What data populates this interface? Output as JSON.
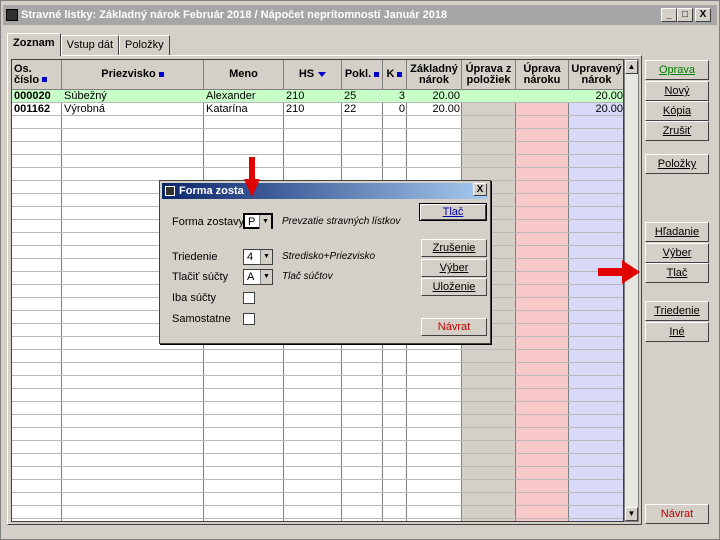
{
  "window": {
    "title": "Stravné lístky:  Základný nárok Február 2018  /  Nápočet neprítomností Január 2018",
    "minimize": "_",
    "maximize": "□",
    "close": "X"
  },
  "tabs": [
    {
      "label": "Zoznam",
      "active": true
    },
    {
      "label": "Vstup dát",
      "active": false
    },
    {
      "label": "Položky",
      "active": false
    }
  ],
  "table": {
    "columns": [
      {
        "label1": "Os.",
        "label2": "číslo",
        "sort": "marker"
      },
      {
        "label1": "Priezvisko",
        "label2": "",
        "sort": "marker"
      },
      {
        "label1": "Meno",
        "label2": "",
        "sort": "none"
      },
      {
        "label1": "HS",
        "label2": "",
        "sort": "desc"
      },
      {
        "label1": "Pokl.",
        "label2": "",
        "sort": "marker"
      },
      {
        "label1": "K",
        "label2": "",
        "sort": "marker"
      },
      {
        "label1": "Základný",
        "label2": "nárok",
        "sort": "none"
      },
      {
        "label1": "Úprava z",
        "label2": "položiek",
        "sort": "none"
      },
      {
        "label1": "Úprava",
        "label2": "nároku",
        "sort": "none"
      },
      {
        "label1": "Upravený",
        "label2": "nárok",
        "sort": "none"
      }
    ],
    "rows": [
      {
        "os": "000020",
        "priezvisko": "Súbežný",
        "meno": "Alexander",
        "hs": "210",
        "pokl": "25",
        "k": "3",
        "zakladny": "20.00",
        "uprava_pol": "",
        "uprava_nar": "",
        "upraveny": "20.00",
        "selected": true
      },
      {
        "os": "001162",
        "priezvisko": "Výrobná",
        "meno": "Katarína",
        "hs": "210",
        "pokl": "22",
        "k": "0",
        "zakladny": "20.00",
        "uprava_pol": "",
        "uprava_nar": "",
        "upraveny": "20.00",
        "selected": false
      }
    ],
    "column_colors": {
      "uprava_pol": "#d4d0c8",
      "uprava_nar": "#f8c8c8",
      "upraveny": "#d8d8f8",
      "selected_row": "#c8ffc8"
    }
  },
  "scrollbar": {
    "up": "▲",
    "down": "▼"
  },
  "side_buttons": {
    "oprava": "Oprava",
    "novy": "Nový",
    "kopia": "Kópia",
    "zrusit": "Zrušiť",
    "polozky": "Položky",
    "hladanie": "Hľadanie",
    "vyber": "Výber",
    "tlac": "Tlač",
    "triedenie": "Triedenie",
    "ine": "Iné",
    "navrat": "Návrat"
  },
  "dialog": {
    "title": "Forma zosta",
    "close": "X",
    "forma_label": "Forma zostavy",
    "forma_value": "P",
    "forma_hint": "Prevzatie stravných lístkov",
    "triedenie_label": "Triedenie",
    "triedenie_value": "4",
    "triedenie_hint": "Stredisko+Priezvisko",
    "tlac_suctov_label": "Tlačiť súčty",
    "tlac_suctov_value": "A",
    "tlac_suctov_hint": "Tlač súčtov",
    "iba_sucty_label": "Iba súčty",
    "samostatne_label": "Samostatne",
    "btn_tlac": "Tlač",
    "btn_zrusenie": "Zrušenie",
    "btn_vyber": "Výber",
    "btn_ulozenie": "Uloženie",
    "btn_navrat": "Návrat",
    "dropdown_glyph": "▼"
  },
  "annotations": {
    "arrow_color": "#e00000"
  }
}
